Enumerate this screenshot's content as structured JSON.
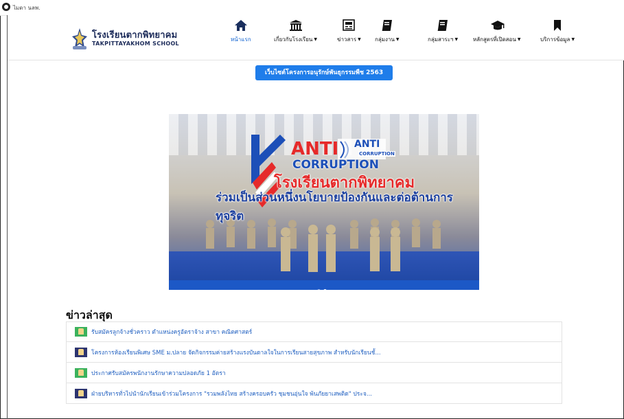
{
  "browser": {
    "site_text": "ไมดา นลพ."
  },
  "brand": {
    "name_th": "โรงเรียนตากพิทยาคม",
    "name_en": "TAKPITTAYAKHOM SCHOOL"
  },
  "nav": [
    {
      "label": "หน้าแรก",
      "icon": "home-icon",
      "dropdown": false,
      "active": true
    },
    {
      "label": "เกี่ยวกับโรงเรียน",
      "icon": "institution-icon",
      "dropdown": true,
      "active": false
    },
    {
      "label": "ข่าวสาร",
      "icon": "newspaper-icon",
      "dropdown": true,
      "active": false
    },
    {
      "label": "กลุ่มงาน",
      "icon": "book-icon",
      "dropdown": true,
      "active": false
    },
    {
      "label": "กลุ่มสาระฯ",
      "icon": "book-icon",
      "dropdown": true,
      "active": false
    },
    {
      "label": "หลักสูตรที่เปิดสอน",
      "icon": "graduation-cap-icon",
      "dropdown": true,
      "active": false
    },
    {
      "label": "บริการข้อมูล",
      "icon": "bookmark-icon",
      "dropdown": true,
      "active": false
    }
  ],
  "promo_button": "เว็บไซต์โครงการอนุรักษ์พันธุกรรมพืช 2563",
  "banner": {
    "anti": "ANTI",
    "anti_logo_text": "ANTI",
    "anti_logo_sub": "CORRUPTION",
    "corruption": "CORRUPTION",
    "school": "โรงเรียนตากพิทยาคม",
    "slogan": "ร่วมเป็นส่วนหนึ่งนโยบายป้องกันและต่อต้านการทุจริต",
    "slides": 2,
    "active_slide": 1
  },
  "news": {
    "title": "ข่าวล่าสุด",
    "items": [
      {
        "text": "รับสมัครลูกจ้างชั่วคราว ตำแหน่งครูอัตราจ้าง สาขา คณิตศาสตร์",
        "thumb": "green"
      },
      {
        "text": "โครงการห้องเรียนพิเศษ SME ม.ปลาย จัดกิจกรรมค่ายสร้างแรงบันดาลใจในการเรียนสายสุขภาพ สำหรับนักเรียนชั้...",
        "thumb": "navy"
      },
      {
        "text": "ประกาศรับสมัครพนักงานรักษาความปลอดภัย 1 อัตรา",
        "thumb": "green"
      },
      {
        "text": "ฝ่ายบริหารทั่วไปนำนักเรียนเข้าร่วมโครงการ \"รวมพลังไทย สร้างครอบครัว ชุมชนอุ่นใจ พ้นภัยยาเสพติด\" ประจ...",
        "thumb": "navy"
      }
    ]
  }
}
